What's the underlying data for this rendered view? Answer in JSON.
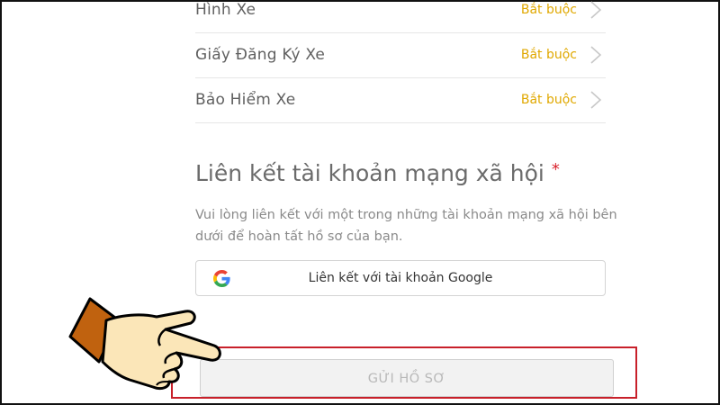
{
  "documents": [
    {
      "label": "Hình Xe",
      "status": "Bắt buộc"
    },
    {
      "label": "Giấy Đăng Ký Xe",
      "status": "Bắt buộc"
    },
    {
      "label": "Bảo Hiểm Xe",
      "status": "Bắt buộc"
    }
  ],
  "social": {
    "title": "Liên kết tài khoản mạng xã hội",
    "required_mark": "*",
    "description": "Vui lòng liên kết với một trong những tài khoản mạng xã hội bên dưới để hoàn tất hồ sơ của bạn.",
    "google_button": "Liên kết với tài khoản Google"
  },
  "submit": {
    "label": "GỬI HỒ SƠ"
  },
  "colors": {
    "required_accent": "#e0a800",
    "required_star": "#d9232d",
    "highlight_box": "#c8202a",
    "hand_sleeve": "#c0620f",
    "hand_skin": "#fbe6b8"
  },
  "icons": {
    "row_chevron": "chevron-right-icon",
    "google": "google-logo-icon",
    "pointer": "pointing-hand-icon"
  }
}
